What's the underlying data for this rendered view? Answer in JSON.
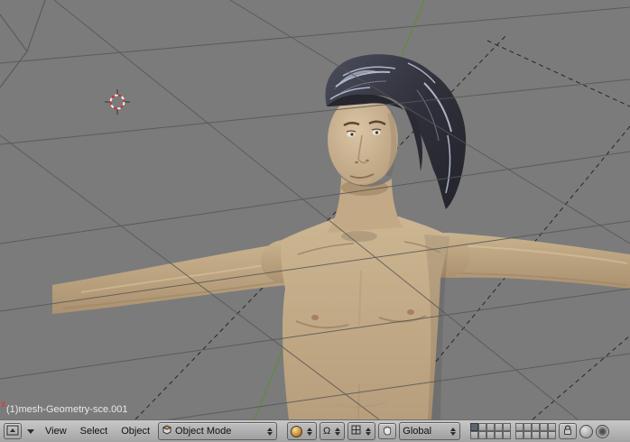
{
  "viewport": {
    "object_label": "(1)mesh-Geometry-sce.001",
    "edge_marker": "x",
    "colors": {
      "background": "#7b7b7b",
      "grid_line": "#565656",
      "axis_y_green": "#5e8c3e",
      "dashed_line": "#262626",
      "cursor_red": "#cc3333",
      "skin": "#c6ae8b",
      "hair": "#33333d",
      "hair_highlight": "#c2cce0"
    }
  },
  "header": {
    "menus": [
      "View",
      "Select",
      "Object"
    ],
    "mode_dropdown": "Object Mode",
    "orientation_dropdown": "Global",
    "pivot_glyph": "Ω",
    "layers": {
      "groups": [
        [
          true,
          false,
          false,
          false,
          false,
          false,
          false,
          false,
          false,
          false
        ],
        [
          false,
          false,
          false,
          false,
          false,
          false,
          false,
          false,
          false,
          false
        ]
      ]
    },
    "icons": {
      "editor_type": "3d-window-icon",
      "collapse": "triangle-down",
      "mode": "object-cube-icon",
      "draw_type": "shaded-sphere-icon",
      "pivot": "pivot-omega-icon",
      "manipulator": "grid-cross-icon",
      "hand": "hand-icon",
      "lock": "padlock-icon",
      "render_buttons": [
        "circle-ring",
        "circle-dot"
      ]
    }
  }
}
